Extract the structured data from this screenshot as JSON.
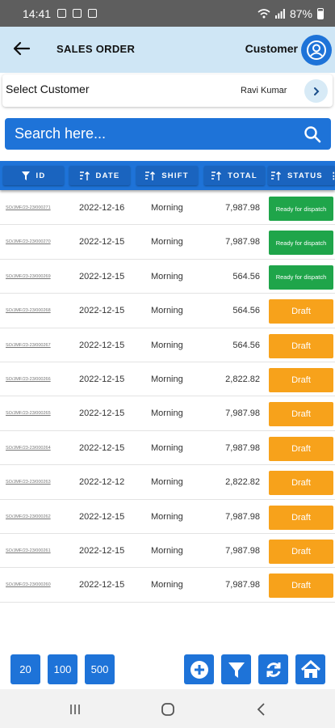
{
  "status_bar": {
    "time": "14:41",
    "battery": "87%"
  },
  "header": {
    "title": "SALES ORDER",
    "customer_label": "Customer"
  },
  "customer": {
    "label": "Select Customer",
    "value": "Ravi Kumar"
  },
  "search": {
    "placeholder": "Search here..."
  },
  "columns": [
    "ID",
    "DATE",
    "SHIFT",
    "TOTAL",
    "STATUS"
  ],
  "orders": [
    {
      "id": "SO/JMF/23-23/000271",
      "date": "2022-12-16",
      "shift": "Morning",
      "total": "7,987.98",
      "status": "Ready for dispatch",
      "status_type": "ready"
    },
    {
      "id": "SO/JMF/23-23/000270",
      "date": "2022-12-15",
      "shift": "Morning",
      "total": "7,987.98",
      "status": "Ready for dispatch",
      "status_type": "ready"
    },
    {
      "id": "SO/JMF/23-23/000269",
      "date": "2022-12-15",
      "shift": "Morning",
      "total": "564.56",
      "status": "Ready for dispatch",
      "status_type": "ready"
    },
    {
      "id": "SO/JMF/23-23/000268",
      "date": "2022-12-15",
      "shift": "Morning",
      "total": "564.56",
      "status": "Draft",
      "status_type": "draft"
    },
    {
      "id": "SO/JMF/23-23/000267",
      "date": "2022-12-15",
      "shift": "Morning",
      "total": "564.56",
      "status": "Draft",
      "status_type": "draft"
    },
    {
      "id": "SO/JMF/23-23/000266",
      "date": "2022-12-15",
      "shift": "Morning",
      "total": "2,822.82",
      "status": "Draft",
      "status_type": "draft"
    },
    {
      "id": "SO/JMF/23-23/000265",
      "date": "2022-12-15",
      "shift": "Morning",
      "total": "7,987.98",
      "status": "Draft",
      "status_type": "draft"
    },
    {
      "id": "SO/JMF/23-23/000264",
      "date": "2022-12-15",
      "shift": "Morning",
      "total": "7,987.98",
      "status": "Draft",
      "status_type": "draft"
    },
    {
      "id": "SO/JMF/23-23/000263",
      "date": "2022-12-12",
      "shift": "Morning",
      "total": "2,822.82",
      "status": "Draft",
      "status_type": "draft"
    },
    {
      "id": "SO/JMF/23-23/000262",
      "date": "2022-12-15",
      "shift": "Morning",
      "total": "7,987.98",
      "status": "Draft",
      "status_type": "draft"
    },
    {
      "id": "SO/JMF/23-23/000261",
      "date": "2022-12-15",
      "shift": "Morning",
      "total": "7,987.98",
      "status": "Draft",
      "status_type": "draft"
    },
    {
      "id": "SO/JMF/23-23/000260",
      "date": "2022-12-15",
      "shift": "Morning",
      "total": "7,987.98",
      "status": "Draft",
      "status_type": "draft"
    },
    {
      "id": "",
      "date": "",
      "shift": "",
      "total": "",
      "status": "",
      "status_type": "draft"
    }
  ],
  "footer": {
    "page_sizes": [
      "20",
      "100",
      "500"
    ],
    "actions": [
      "add-icon",
      "filter-icon",
      "refresh-icon",
      "home-icon"
    ]
  },
  "colors": {
    "primary": "#1e73d8",
    "header_bg": "#cfe6f5",
    "ready": "#1fa54a",
    "draft": "#f7a21b"
  }
}
